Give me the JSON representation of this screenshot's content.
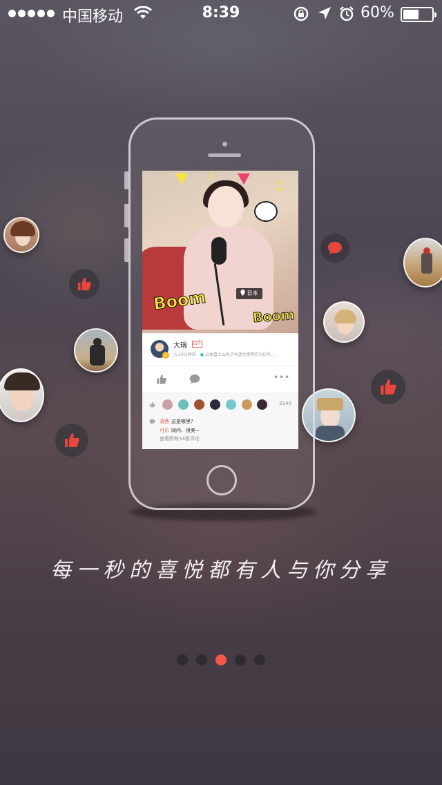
{
  "status_bar": {
    "carrier": "中国移动",
    "time": "8:39",
    "battery": "60%",
    "battery_level": 0.6
  },
  "post": {
    "location_tag": "日本",
    "photo_stickers": [
      "Boom",
      "Boom"
    ],
    "username": "大瑞",
    "level": "LV7",
    "time_ago": "20分钟前",
    "address": "日本富士山丸子大道大街旁区303号...",
    "more": "•••",
    "like_count": "2140",
    "comments": [
      {
        "user": "清茜",
        "text": "这是哪里?"
      },
      {
        "user": "可乐",
        "text": "同问、很美~"
      }
    ],
    "view_all": "查看所有53条评论"
  },
  "tagline": "每一秒的喜悦都有人与你分享",
  "pagination": {
    "count": 5,
    "active_index": 2
  },
  "colors": {
    "accent": "#f25843",
    "like_red": "#e8473d",
    "bubble_bg": "#3c373e"
  },
  "icons": [
    "wifi-icon",
    "lock-rotation-icon",
    "location-arrow-icon",
    "alarm-icon",
    "thumbs-up-icon",
    "chat-bubble-icon",
    "map-pin-icon"
  ]
}
